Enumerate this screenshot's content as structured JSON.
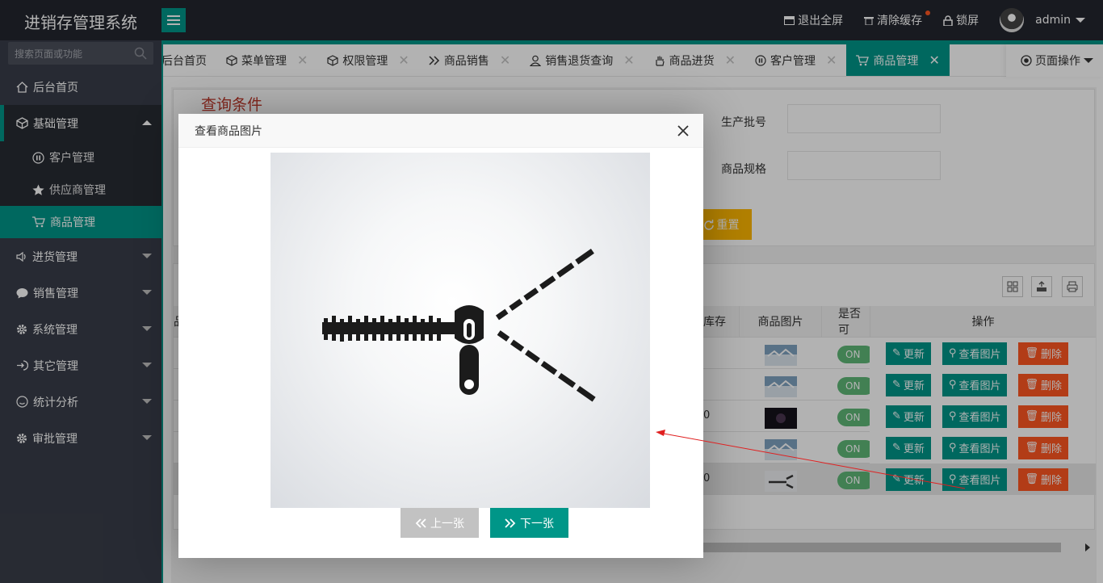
{
  "app": {
    "title": "进销存管理系统"
  },
  "topbar": {
    "fullscreen": "退出全屏",
    "clear_cache": "清除缓存",
    "lock": "锁屏",
    "user": "admin"
  },
  "sidebar": {
    "search_placeholder": "搜索页面或功能",
    "items": [
      {
        "label": "后台首页"
      },
      {
        "label": "基础管理",
        "open": true
      },
      {
        "label": "进货管理"
      },
      {
        "label": "销售管理"
      },
      {
        "label": "系统管理"
      },
      {
        "label": "其它管理"
      },
      {
        "label": "统计分析"
      },
      {
        "label": "审批管理"
      }
    ],
    "subitems": [
      {
        "label": "客户管理"
      },
      {
        "label": "供应商管理"
      },
      {
        "label": "商品管理",
        "active": true
      }
    ]
  },
  "tabs": [
    {
      "label": "后台首页"
    },
    {
      "label": "菜单管理"
    },
    {
      "label": "权限管理"
    },
    {
      "label": "商品销售"
    },
    {
      "label": "销售退货查询"
    },
    {
      "label": "商品进货"
    },
    {
      "label": "客户管理"
    },
    {
      "label": "商品管理",
      "active": true
    }
  ],
  "tab_ops": "页面操作",
  "query": {
    "title": "查询条件",
    "batch_label": "生产批号",
    "spec_label": "商品规格",
    "reset": "重置"
  },
  "table": {
    "headers": {
      "col_cut": "品",
      "stock": "库存",
      "image": "商品图片",
      "available": "是否可",
      "ops": "操作"
    },
    "rows": [
      {
        "stock": "",
        "toggle": "ON"
      },
      {
        "stock": "",
        "toggle": "ON"
      },
      {
        "stock": "0",
        "toggle": "ON"
      },
      {
        "stock": "",
        "toggle": "ON"
      },
      {
        "stock": "0",
        "toggle": "ON"
      }
    ],
    "btn_update": "更新",
    "btn_view": "查看图片",
    "btn_delete": "删除"
  },
  "modal": {
    "title": "查看商品图片",
    "prev": "上一张",
    "next": "下一张"
  },
  "colors": {
    "accent": "#009688",
    "warn": "#ffb800",
    "danger": "#ff5722",
    "dark": "#23262e",
    "side": "#393d49"
  }
}
